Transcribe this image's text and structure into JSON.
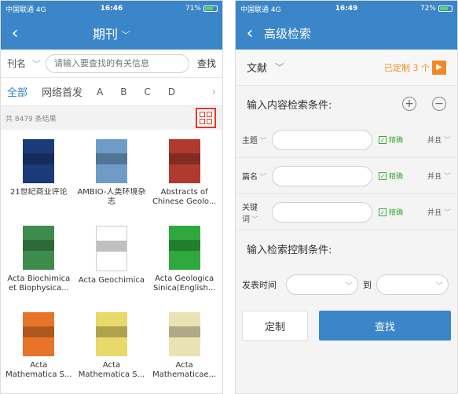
{
  "left": {
    "status": {
      "carrier": "中国联通 4G",
      "time": "16:46",
      "battery": "71%",
      "battery_level": 0.71
    },
    "nav": {
      "title": "期刊",
      "back_icon": "chevron-left-icon"
    },
    "search": {
      "field_type": "刊名",
      "placeholder": "请输入要查找的有关信息",
      "find_label": "查找"
    },
    "tabs": {
      "all": "全部",
      "online_first": "网络首发",
      "letters": [
        "A",
        "B",
        "C",
        "D"
      ]
    },
    "result_count": "共 8479 条结果",
    "journals": [
      {
        "title": "21世纪商业评论",
        "cover_color": "#1b3a7a"
      },
      {
        "title": "AMBIO-人类环境杂志",
        "cover_color": "#6f9cc7"
      },
      {
        "title": "Abstracts of Chinese Geolo...",
        "cover_color": "#b03a2e"
      },
      {
        "title": "Acta Biochimica et Biophysica...",
        "cover_color": "#3d8b4d"
      },
      {
        "title": "Acta Geochimica",
        "cover_color": "#ffffff"
      },
      {
        "title": "Acta Geologica Sinica(English...",
        "cover_color": "#2fa83e"
      },
      {
        "title": "Acta Mathematica S...",
        "cover_color": "#e8742a"
      },
      {
        "title": "Acta Mathematica S...",
        "cover_color": "#e8d96a"
      },
      {
        "title": "Acta Mathematicae...",
        "cover_color": "#e9e3b4"
      }
    ]
  },
  "right": {
    "status": {
      "carrier": "中国联通 4G",
      "time": "16:49",
      "battery": "72%",
      "battery_level": 0.72
    },
    "nav": {
      "title": "高级检索",
      "back_icon": "chevron-left-icon"
    },
    "doc_type": {
      "label": "文献",
      "customized": "已定制 3 个"
    },
    "content_section": "输入内容检索条件:",
    "conditions": [
      {
        "field": "主题",
        "precise": "精确",
        "logic": "并且"
      },
      {
        "field": "篇名",
        "precise": "精确",
        "logic": "并且"
      },
      {
        "field": "关键词",
        "precise": "精确",
        "logic": "并且"
      }
    ],
    "control_section": "输入检索控制条件:",
    "date": {
      "label": "发表时间",
      "to": "到"
    },
    "buttons": {
      "customize": "定制",
      "find": "查找"
    }
  }
}
